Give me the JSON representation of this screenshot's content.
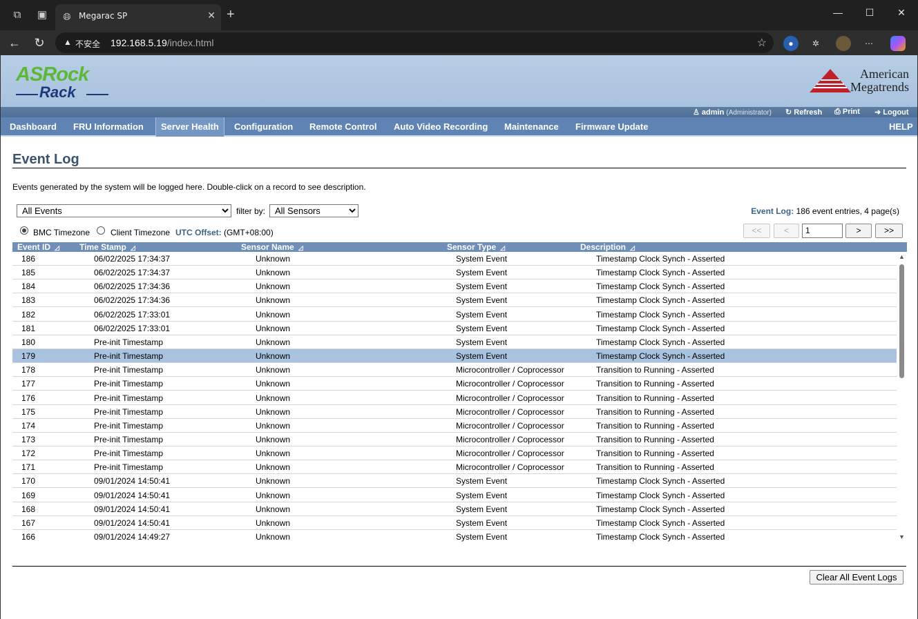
{
  "browser": {
    "tab_title": "Megarac SP",
    "security_label": "不安全",
    "url_host": "192.168.5.19",
    "url_path": "/index.html"
  },
  "header": {
    "logo_line1": "ASRock",
    "logo_line2": "Rack",
    "brand_line1": "American",
    "brand_line2": "Megatrends",
    "user": "admin",
    "role": "(Administrator)",
    "refresh": "Refresh",
    "print": "Print",
    "logout": "Logout"
  },
  "menu": {
    "items": [
      "Dashboard",
      "FRU Information",
      "Server Health",
      "Configuration",
      "Remote Control",
      "Auto Video Recording",
      "Maintenance",
      "Firmware Update"
    ],
    "active": "Server Health",
    "help": "HELP"
  },
  "page": {
    "title": "Event Log",
    "description": "Events generated by the system will be logged here. Double-click on a record to see description.",
    "event_filter": "All Events",
    "filter_by_label": "filter by:",
    "sensor_filter": "All Sensors",
    "event_log_label": "Event Log:",
    "event_log_summary": "186 event entries, 4 page(s)",
    "tz_bmc": "BMC Timezone",
    "tz_client": "Client Timezone",
    "utc_label": "UTC Offset:",
    "utc_value": "(GMT+08:00)",
    "pager": {
      "first": "<<",
      "prev": "<",
      "page": "1",
      "next": ">",
      "last": ">>"
    },
    "clear_button": "Clear All Event Logs"
  },
  "table": {
    "columns": [
      "Event ID",
      "Time Stamp",
      "Sensor Name",
      "Sensor Type",
      "Description"
    ],
    "selected_id": "179",
    "rows": [
      [
        "186",
        "06/02/2025 17:34:37",
        "Unknown",
        "System Event",
        "Timestamp Clock Synch - Asserted"
      ],
      [
        "185",
        "06/02/2025 17:34:37",
        "Unknown",
        "System Event",
        "Timestamp Clock Synch - Asserted"
      ],
      [
        "184",
        "06/02/2025 17:34:36",
        "Unknown",
        "System Event",
        "Timestamp Clock Synch - Asserted"
      ],
      [
        "183",
        "06/02/2025 17:34:36",
        "Unknown",
        "System Event",
        "Timestamp Clock Synch - Asserted"
      ],
      [
        "182",
        "06/02/2025 17:33:01",
        "Unknown",
        "System Event",
        "Timestamp Clock Synch - Asserted"
      ],
      [
        "181",
        "06/02/2025 17:33:01",
        "Unknown",
        "System Event",
        "Timestamp Clock Synch - Asserted"
      ],
      [
        "180",
        "Pre-init Timestamp",
        "Unknown",
        "System Event",
        "Timestamp Clock Synch - Asserted"
      ],
      [
        "179",
        "Pre-init Timestamp",
        "Unknown",
        "System Event",
        "Timestamp Clock Synch - Asserted"
      ],
      [
        "178",
        "Pre-init Timestamp",
        "Unknown",
        "Microcontroller / Coprocessor",
        "Transition to Running - Asserted"
      ],
      [
        "177",
        "Pre-init Timestamp",
        "Unknown",
        "Microcontroller / Coprocessor",
        "Transition to Running - Asserted"
      ],
      [
        "176",
        "Pre-init Timestamp",
        "Unknown",
        "Microcontroller / Coprocessor",
        "Transition to Running - Asserted"
      ],
      [
        "175",
        "Pre-init Timestamp",
        "Unknown",
        "Microcontroller / Coprocessor",
        "Transition to Running - Asserted"
      ],
      [
        "174",
        "Pre-init Timestamp",
        "Unknown",
        "Microcontroller / Coprocessor",
        "Transition to Running - Asserted"
      ],
      [
        "173",
        "Pre-init Timestamp",
        "Unknown",
        "Microcontroller / Coprocessor",
        "Transition to Running - Asserted"
      ],
      [
        "172",
        "Pre-init Timestamp",
        "Unknown",
        "Microcontroller / Coprocessor",
        "Transition to Running - Asserted"
      ],
      [
        "171",
        "Pre-init Timestamp",
        "Unknown",
        "Microcontroller / Coprocessor",
        "Transition to Running - Asserted"
      ],
      [
        "170",
        "09/01/2024 14:50:41",
        "Unknown",
        "System Event",
        "Timestamp Clock Synch - Asserted"
      ],
      [
        "169",
        "09/01/2024 14:50:41",
        "Unknown",
        "System Event",
        "Timestamp Clock Synch - Asserted"
      ],
      [
        "168",
        "09/01/2024 14:50:41",
        "Unknown",
        "System Event",
        "Timestamp Clock Synch - Asserted"
      ],
      [
        "167",
        "09/01/2024 14:50:41",
        "Unknown",
        "System Event",
        "Timestamp Clock Synch - Asserted"
      ],
      [
        "166",
        "09/01/2024 14:49:27",
        "Unknown",
        "System Event",
        "Timestamp Clock Synch - Asserted"
      ]
    ]
  },
  "colors": {
    "header_bg": "#b7cde4",
    "menu_bg": "#5f83b3",
    "selected_row": "#a9c2df",
    "title": "#3d526e"
  }
}
